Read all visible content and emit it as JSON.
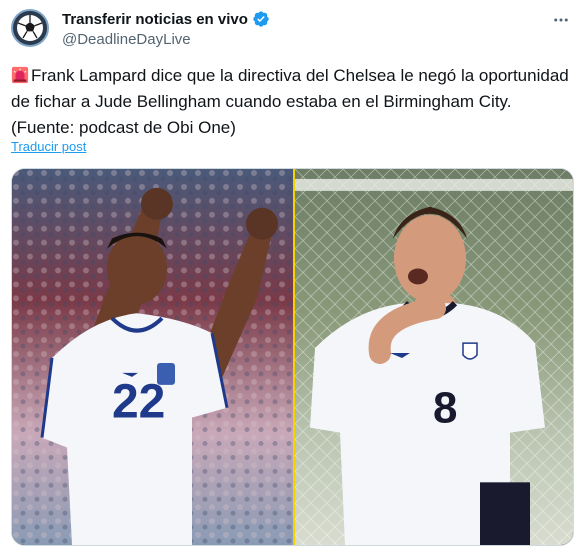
{
  "account": {
    "display_name": "Transferir noticias en vivo",
    "handle": "@DeadlineDayLive",
    "verified": true,
    "avatar_icon": "football-icon"
  },
  "tweet": {
    "emoji_icon": "police-light-icon",
    "text": "Frank Lampard dice que la directiva del Chelsea le negó la oportunidad de fichar a Jude Bellingham cuando estaba en el Birmingham City. (Fuente: podcast de Obi One)",
    "translate_label": "Traducir post"
  },
  "media": {
    "left_shirt_number": "22",
    "right_shirt_number": "8",
    "divider_color": "#f4d400"
  },
  "colors": {
    "link": "#1d9bf0",
    "verified": "#1d9bf0",
    "secondary_text": "#536471"
  }
}
